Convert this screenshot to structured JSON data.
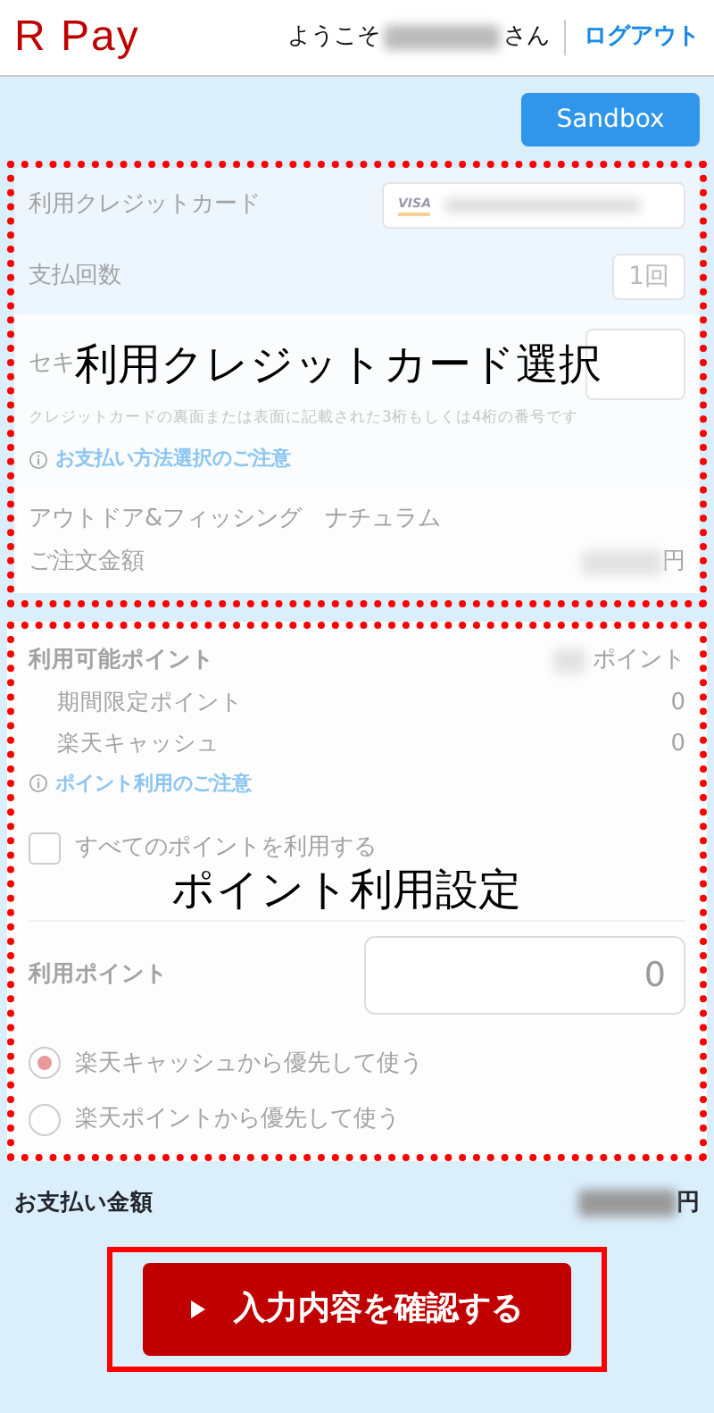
{
  "header": {
    "logo": "R Pay",
    "welcome_prefix": "ようこそ",
    "welcome_suffix": "さん",
    "logout": "ログアウト"
  },
  "sandbox_button": "Sandbox",
  "card_section": {
    "annotation": "利用クレジットカード選択",
    "card_label": "利用クレジットカード",
    "card_brand": "VISA",
    "installments_label": "支払回数",
    "installments_value": "1回",
    "security_label": "セキ",
    "security_hint": "クレジットカードの裏面または表面に記載された3桁もしくは4桁の番号です",
    "notice_link": "お支払い方法選択のご注意",
    "shop_name": "アウトドア&フィッシング　ナチュラム",
    "order_amount_label": "ご注文金額",
    "order_amount_unit": "円"
  },
  "points_section": {
    "annotation": "ポイント利用設定",
    "available_label": "利用可能ポイント",
    "available_unit": "ポイント",
    "sub_rows": [
      {
        "label": "期間限定ポイント",
        "value": "0"
      },
      {
        "label": "楽天キャッシュ",
        "value": "0"
      }
    ],
    "notice_link": "ポイント利用のご注意",
    "use_all": {
      "label": "すべてのポイントを利用する",
      "checked": false
    },
    "use_points_label": "利用ポイント",
    "use_points_value": "0",
    "priority_options": [
      {
        "label": "楽天キャッシュから優先して使う",
        "selected": true
      },
      {
        "label": "楽天ポイントから優先して使う",
        "selected": false
      }
    ]
  },
  "total": {
    "label": "お支払い金額",
    "unit": "円"
  },
  "confirm_button": "入力内容を確認する"
}
